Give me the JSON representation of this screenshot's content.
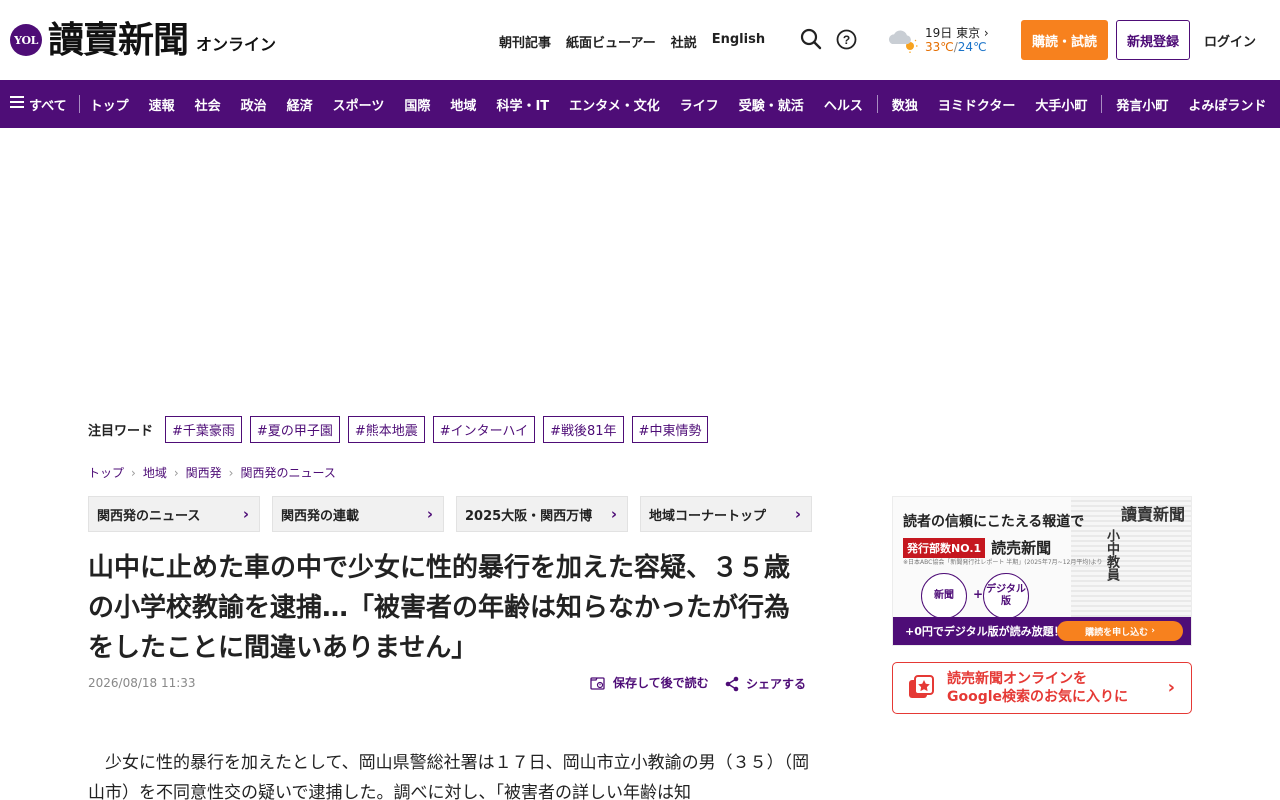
{
  "header": {
    "logo_badge": "YOL",
    "logo_main": "讀賣新聞",
    "logo_sub": "オンライン",
    "top_links": [
      "朝刊記事",
      "紙面ビューアー",
      "社説",
      "English"
    ],
    "weather": {
      "date_city": "19日 東京",
      "high": "33℃",
      "separator": "/",
      "low": "24℃"
    },
    "subscribe_label": "購読・試読",
    "register_label": "新規登録",
    "login_label": "ログイン"
  },
  "nav": {
    "all_label": "すべて",
    "items_a": [
      "トップ",
      "速報",
      "社会",
      "政治",
      "経済",
      "スポーツ",
      "国際",
      "地域",
      "科学・IT",
      "エンタメ・文化",
      "ライフ",
      "受験・就活",
      "ヘルス"
    ],
    "items_b": [
      "数独",
      "ヨミドクター",
      "大手小町"
    ],
    "items_c": [
      "発言小町",
      "よみぽランド"
    ]
  },
  "trending": {
    "label": "注目ワード",
    "tags": [
      "#千葉豪雨",
      "#夏の甲子園",
      "#熊本地震",
      "#インターハイ",
      "#戦後81年",
      "#中東情勢"
    ]
  },
  "breadcrumb": [
    "トップ",
    "地域",
    "関西発",
    "関西発のニュース"
  ],
  "section_tabs": [
    "関西発のニュース",
    "関西発の連載",
    "2025大阪・関西万博",
    "地域コーナートップ"
  ],
  "article": {
    "title": "山中に止めた車の中で少女に性的暴行を加えた容疑、３５歳の小学校教諭を逮捕…「被害者の年齢は知らなかったが行為をしたことに間違いありません」",
    "date": "2026/08/18 11:33",
    "save_label": "保存して後で読む",
    "share_label": "シェアする",
    "body": "少女に性的暴行を加えたとして、岡山県警総社署は１７日、岡山市立小教諭の男（３５）（岡山市）を不同意性交の疑いで逮捕した。調べに対し、「被害者の詳しい年齢は知"
  },
  "sidebar": {
    "promo": {
      "headline": "読者の信頼にこたえる報道で",
      "badge": "発行部数NO.1",
      "badge_name": "読売新聞",
      "note": "※日本ABC協会「新聞発行社レポート 半期」(2025年7月~12月平均)より",
      "circle_a": "新聞",
      "plus": "+",
      "circle_b": "デジタル版",
      "paper_logo": "讀賣新聞",
      "paper_headline": "小中教員",
      "bar_text": "+0円でデジタル版が読み放題！",
      "bar_button": "購読を申し込む"
    },
    "google_fav": {
      "line1": "読売新聞オンラインを",
      "line2": "Google検索のお気に入りに"
    }
  },
  "colors": {
    "brand_purple": "#4e0d77",
    "accent_orange": "#f7811e",
    "google_red": "#e53935"
  }
}
